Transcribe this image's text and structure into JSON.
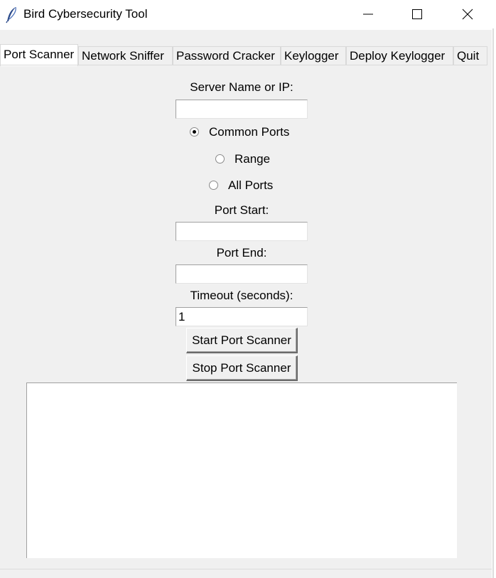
{
  "window": {
    "title": "Bird Cybersecurity Tool",
    "icon": "feather-icon",
    "controls": [
      "minimize-icon",
      "maximize-icon",
      "close-icon"
    ]
  },
  "tabs": [
    {
      "label": "Port Scanner",
      "active": true
    },
    {
      "label": "Network Sniffer",
      "active": false
    },
    {
      "label": "Password Cracker",
      "active": false
    },
    {
      "label": "Keylogger",
      "active": false
    },
    {
      "label": "Deploy Keylogger",
      "active": false
    },
    {
      "label": "Quit",
      "active": false
    }
  ],
  "form": {
    "server_label": "Server Name or IP:",
    "server_value": "",
    "radios": [
      {
        "label": "Common Ports",
        "selected": true
      },
      {
        "label": "Range",
        "selected": false
      },
      {
        "label": "All Ports",
        "selected": false
      }
    ],
    "port_start_label": "Port Start:",
    "port_start_value": "",
    "port_end_label": "Port End:",
    "port_end_value": "",
    "timeout_label": "Timeout (seconds):",
    "timeout_value": "1"
  },
  "buttons": {
    "start": "Start Port Scanner",
    "stop": "Stop Port Scanner"
  },
  "output": {
    "text": ""
  }
}
